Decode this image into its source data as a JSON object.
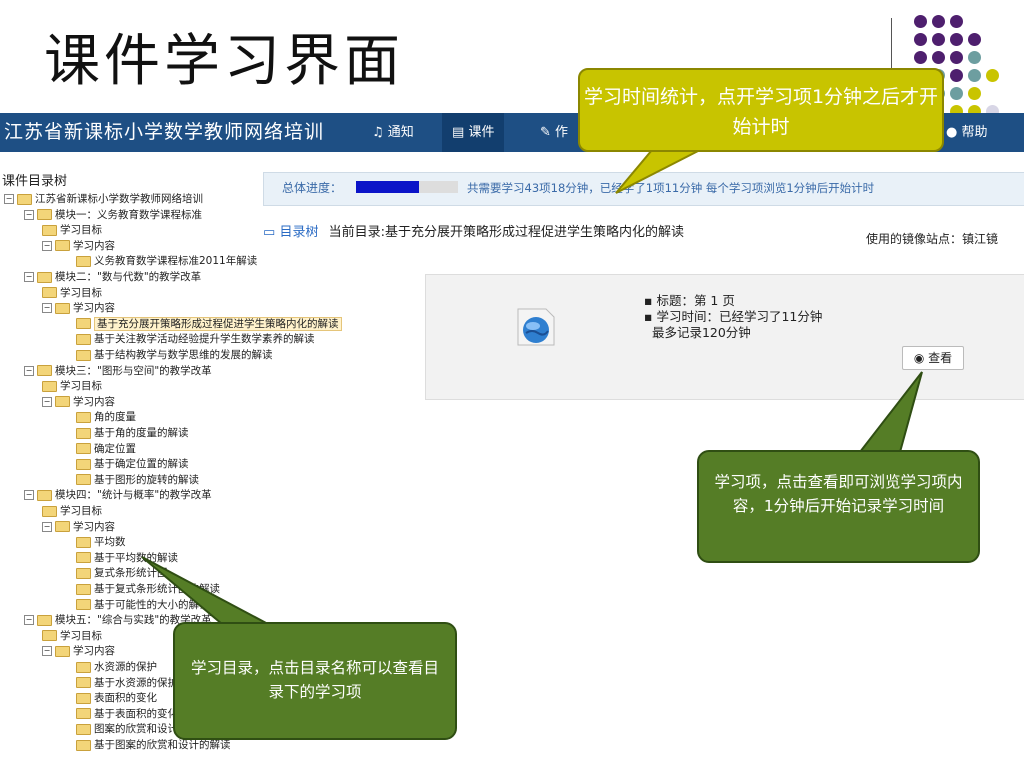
{
  "slide": {
    "title": "课件学习界面"
  },
  "theme": {
    "purple": "#4e1f6e",
    "teal": "#6d9ea0",
    "yellow": "#c9c400",
    "lavender": "#d8d6e6",
    "nav": "#1e4f84"
  },
  "navbar": {
    "brand": "江苏省新课标小学数学教师网络培训",
    "items": [
      {
        "icon": "bell-icon",
        "label": "通知"
      },
      {
        "icon": "film-icon",
        "label": "课件"
      },
      {
        "icon": "pencil-icon",
        "label": "作"
      },
      {
        "icon": "info-icon",
        "label": "帮助"
      }
    ]
  },
  "tree": {
    "title": "课件目录树",
    "rows": [
      {
        "text": "江苏省新课标小学数学教师网络培训",
        "level": 0,
        "pm": "⊟"
      },
      {
        "text": "模块一：义务教育数学课程标准",
        "level": 1,
        "pm": "⊟"
      },
      {
        "text": "学习目标",
        "level": 2,
        "pm": ""
      },
      {
        "text": "学习内容",
        "level": 2,
        "pm": "⊟"
      },
      {
        "text": "义务教育数学课程标准2011年解读",
        "level": 3,
        "pm": ""
      },
      {
        "text": "模块二：\"数与代数\"的教学改革",
        "level": 1,
        "pm": "⊟"
      },
      {
        "text": "学习目标",
        "level": 2,
        "pm": ""
      },
      {
        "text": "学习内容",
        "level": 2,
        "pm": "⊟"
      },
      {
        "text": "基于充分展开策略形成过程促进学生策略内化的解读",
        "level": 3,
        "pm": "",
        "selected": true
      },
      {
        "text": "基于关注教学活动经验提升学生数学素养的解读",
        "level": 3,
        "pm": ""
      },
      {
        "text": "基于结构教学与数学思维的发展的解读",
        "level": 3,
        "pm": ""
      },
      {
        "text": "模块三：\"图形与空间\"的教学改革",
        "level": 1,
        "pm": "⊟"
      },
      {
        "text": "学习目标",
        "level": 2,
        "pm": ""
      },
      {
        "text": "学习内容",
        "level": 2,
        "pm": "⊟"
      },
      {
        "text": "角的度量",
        "level": 3,
        "pm": ""
      },
      {
        "text": "基于角的度量的解读",
        "level": 3,
        "pm": ""
      },
      {
        "text": "确定位置",
        "level": 3,
        "pm": ""
      },
      {
        "text": "基于确定位置的解读",
        "level": 3,
        "pm": ""
      },
      {
        "text": "基于图形的旋转的解读",
        "level": 3,
        "pm": ""
      },
      {
        "text": "模块四：\"统计与概率\"的教学改革",
        "level": 1,
        "pm": "⊟"
      },
      {
        "text": "学习目标",
        "level": 2,
        "pm": ""
      },
      {
        "text": "学习内容",
        "level": 2,
        "pm": "⊟"
      },
      {
        "text": "平均数",
        "level": 3,
        "pm": ""
      },
      {
        "text": "基于平均数的解读",
        "level": 3,
        "pm": ""
      },
      {
        "text": "复式条形统计图",
        "level": 3,
        "pm": ""
      },
      {
        "text": "基于复式条形统计图的解读",
        "level": 3,
        "pm": ""
      },
      {
        "text": "基于可能性的大小的解读",
        "level": 3,
        "pm": ""
      },
      {
        "text": "模块五：\"综合与实践\"的教学改革",
        "level": 1,
        "pm": "⊟"
      },
      {
        "text": "学习目标",
        "level": 2,
        "pm": ""
      },
      {
        "text": "学习内容",
        "level": 2,
        "pm": "⊟"
      },
      {
        "text": "水资源的保护",
        "level": 3,
        "pm": ""
      },
      {
        "text": "基于水资源的保护的解读",
        "level": 3,
        "pm": ""
      },
      {
        "text": "表面积的变化",
        "level": 3,
        "pm": ""
      },
      {
        "text": "基于表面积的变化的解读",
        "level": 3,
        "pm": ""
      },
      {
        "text": "图案的欣赏和设计",
        "level": 3,
        "pm": ""
      },
      {
        "text": "基于图案的欣赏和设计的解读",
        "level": 3,
        "pm": ""
      }
    ]
  },
  "progress": {
    "label": "总体进度：",
    "fraction": 0.62,
    "text": "共需要学习43项18分钟，已经学了1项11分钟  每个学习项浏览1分钟后开始计时"
  },
  "directory": {
    "link": "目录树",
    "current": "当前目录:基于充分展开策略形成过程促进学生策略内化的解读",
    "mirror": "使用的镜像站点：镇江镜"
  },
  "item": {
    "title": "标题：第 1 页",
    "study_time": "学习时间：已经学习了11分钟",
    "max_record": "最多记录120分钟",
    "view_label": "查看"
  },
  "callouts": {
    "timing": "学习时间统计，点开学习项1分钟之后才开始计时",
    "item": "学习项，点击查看即可浏览学习项内容，1分钟后开始记录学习时间",
    "directory": "学习目录，点击目录名称可以查看目录下的学习项"
  }
}
